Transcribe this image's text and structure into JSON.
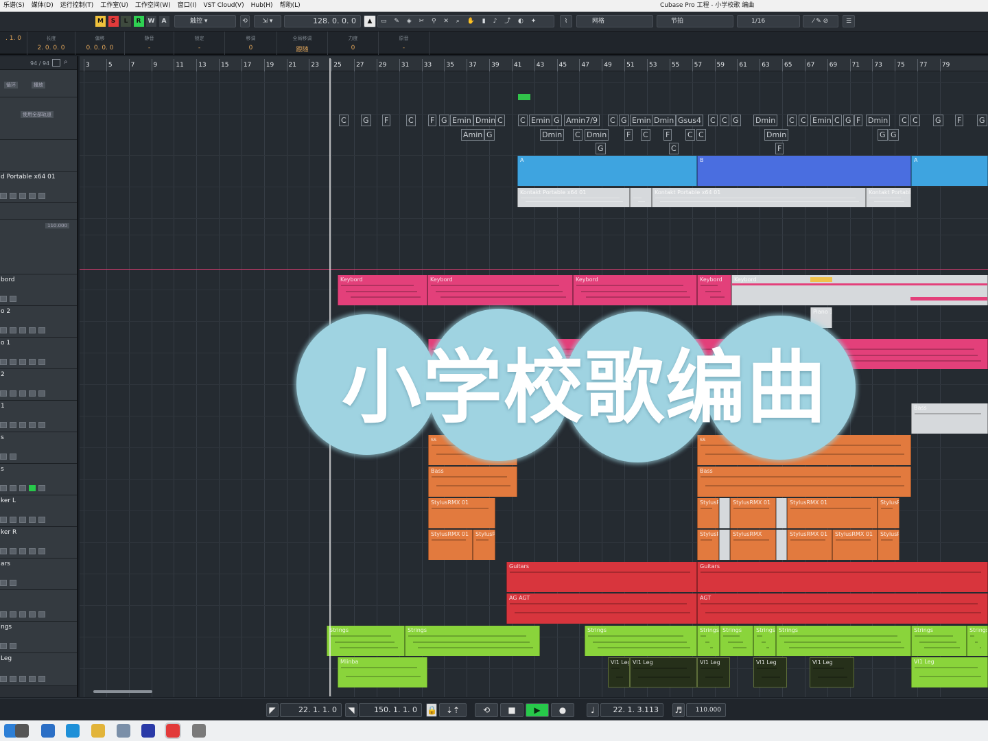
{
  "menubar": {
    "items": [
      "乐谱(S)",
      "媒体(D)",
      "运行控制(T)",
      "工作室(U)",
      "工作空间(W)",
      "窗口(I)",
      "VST Cloud(V)",
      "Hub(H)",
      "帮助(L)"
    ],
    "window_title": "Cubase Pro 工程 - 小学校歌 编曲"
  },
  "toolbar": {
    "modes": [
      "M",
      "S",
      "L",
      "R",
      "W",
      "A"
    ],
    "mode_colors": [
      "#f0c23c",
      "#e23b3b",
      "#3e4a3e",
      "#2fd152",
      "#3a4046",
      "#3a4046"
    ],
    "touch_mode": "触控",
    "position": "128. 0. 0.   0",
    "snap_type": "网格",
    "grid_type": "节拍",
    "quantize": "1/16"
  },
  "infoline": {
    "cells": [
      {
        "label": "",
        "value": ". 1.   0"
      },
      {
        "label": "长度",
        "value": "2. 0. 0.   0"
      },
      {
        "label": "偏移",
        "value": "0. 0. 0.   0"
      },
      {
        "label": "静音",
        "value": "-"
      },
      {
        "label": "锁定",
        "value": "-"
      },
      {
        "label": "移调",
        "value": "0"
      },
      {
        "label": "全局移调",
        "value": "跟随"
      },
      {
        "label": "力度",
        "value": "0"
      },
      {
        "label": "原音",
        "value": "-"
      }
    ]
  },
  "track_list": {
    "count": "94 / 94",
    "tracks": [
      {
        "name": "",
        "tag1": "循环",
        "tag2": "播放"
      },
      {
        "name": "",
        "tag1": "",
        "tag2": "使用全部轨道"
      },
      {
        "name": "",
        "tag1": "",
        "tag2": ""
      },
      {
        "name": "d Portable x64 01",
        "tag1": "",
        "tag2": ""
      },
      {
        "name": "",
        "tag1": "",
        "tag2": ""
      },
      {
        "name": "",
        "tag1": "110.000",
        "tag2": ""
      },
      {
        "name": "bord",
        "tag1": "",
        "tag2": ""
      },
      {
        "name": "o 2",
        "tag1": "",
        "tag2": ""
      },
      {
        "name": "o 1",
        "tag1": "",
        "tag2": ""
      },
      {
        "name": "2",
        "tag1": "",
        "tag2": ""
      },
      {
        "name": "1",
        "tag1": "",
        "tag2": ""
      },
      {
        "name": "s",
        "tag1": "",
        "tag2": ""
      },
      {
        "name": "s",
        "tag1": "",
        "tag2": ""
      },
      {
        "name": "ker L",
        "tag1": "",
        "tag2": ""
      },
      {
        "name": "ker R",
        "tag1": "",
        "tag2": ""
      },
      {
        "name": "ars",
        "tag1": "",
        "tag2": ""
      },
      {
        "name": "",
        "tag1": "",
        "tag2": ""
      },
      {
        "name": "ngs",
        "tag1": "",
        "tag2": ""
      },
      {
        "name": "Leg",
        "tag1": "",
        "tag2": ""
      }
    ]
  },
  "ruler": {
    "bars": [
      "3",
      "5",
      "7",
      "9",
      "11",
      "13",
      "15",
      "17",
      "19",
      "21",
      "23",
      "25",
      "27",
      "29",
      "31",
      "33",
      "35",
      "37",
      "39",
      "41",
      "43",
      "45",
      "47",
      "49",
      "51",
      "53",
      "55",
      "57",
      "59",
      "61",
      "63",
      "65",
      "67",
      "69",
      "71",
      "73",
      "75",
      "77",
      "79"
    ]
  },
  "chords_row1": [
    "C",
    "G",
    "F",
    "C",
    "F",
    "G",
    "Emin",
    "Dmin",
    "C",
    "C",
    "Emin",
    "G",
    "Amin7/9",
    "C",
    "G",
    "Emin",
    "Dmin",
    "Gsus4",
    "C",
    "C",
    "G",
    "Dmin",
    "C",
    "C",
    "Emin",
    "C",
    "G",
    "F",
    "Dmin",
    "C",
    "C",
    "G",
    "F",
    "G"
  ],
  "chords_row2": [
    "Amin",
    "G",
    "Dmin",
    "C",
    "Dmin",
    "F",
    "C",
    "F",
    "C",
    "C",
    "Dmin",
    "G",
    "G"
  ],
  "chords_row3": [
    "G",
    "C",
    "F"
  ],
  "arranger": {
    "labels": [
      "A",
      "B",
      "A"
    ],
    "colors": [
      "#3ea4e0",
      "#4a6ee0",
      "#3ea4e0"
    ]
  },
  "clip_labels": {
    "kontakt": "Kontakt Portable x64 01",
    "kontakt_short": "Kontakt Portable",
    "keyboard": "Keybord",
    "piano": "Piano 1",
    "bass": "Bass",
    "bass_cut": "ss",
    "stylus": "StylusRMX 01",
    "stylus_short": "StylusR",
    "stylus_mid": "StylusRMX",
    "guitars": "Guitars",
    "agt": "AG AGT",
    "agt2": "AGT",
    "strings": "Strings",
    "marimba": "Mlinba",
    "vl1": "Vl1 Leg"
  },
  "overlay_title": "小学校歌编曲",
  "transport": {
    "left_locator": "22. 1. 1.   0",
    "right_locator": "150. 1. 1.   0",
    "position": "22. 1. 3.113",
    "tempo": "110.000",
    "play_color": "#27c94a"
  },
  "taskbar": {
    "icons": [
      "windows-icon",
      "task-view-icon",
      "file-explorer-icon",
      "edge-icon",
      "chrome-icon",
      "notes-icon",
      "app-icon",
      "cubase-icon",
      "clock-icon"
    ]
  }
}
